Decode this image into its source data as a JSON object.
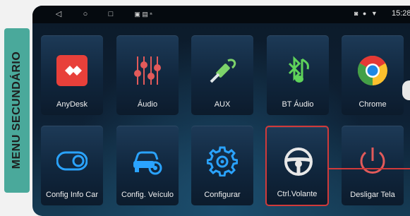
{
  "side_label": "MENU SECUNDÁRIO",
  "status_bar": {
    "time": "15:28"
  },
  "apps_row1": [
    {
      "label": "AnyDesk"
    },
    {
      "label": "Áudio"
    },
    {
      "label": "AUX"
    },
    {
      "label": "BT Áudio"
    },
    {
      "label": "Chrome"
    }
  ],
  "apps_row2": [
    {
      "label": "Config Info Car"
    },
    {
      "label": "Config. Veículo"
    },
    {
      "label": "Configurar"
    },
    {
      "label": "Ctrl.Volante"
    },
    {
      "label": "Desligar Tela"
    }
  ],
  "colors": {
    "label_bg": "#4aa99b",
    "highlight": "#d13a3a",
    "anydesk": "#e8403a",
    "audio_slider": "#e25a5a",
    "aux": "#7dd36a",
    "bt_audio": "#5fd35a",
    "config_blue": "#2aa3ff",
    "power_red": "#e25a5a"
  }
}
